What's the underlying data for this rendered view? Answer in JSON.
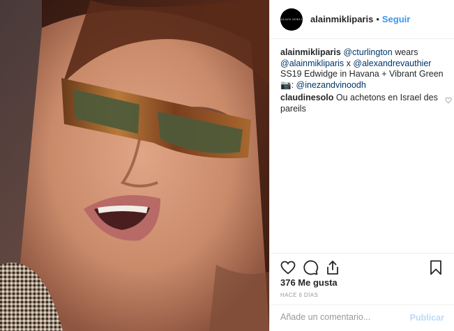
{
  "photo": {
    "alt": "",
    "colors": {
      "hair": "#4a2418",
      "skin": "#c98a6a",
      "lens": "#4d5a3a",
      "frame": "#9a5a2a",
      "lips": "#b86a66",
      "jacket": "#8a7a6a"
    }
  },
  "header": {
    "username": "alainmikliparis",
    "separator": "•",
    "follow_label": "Seguir",
    "avatar_text": "ALAIN MIKLI"
  },
  "caption": {
    "username": "alainmikliparis",
    "parts": [
      "@cturlington",
      " wears ",
      "@alainmikliparis",
      " x ",
      "@alexandrevauthier",
      " SS19 Edwidge in Havana + Vibrant Green ",
      "📷",
      ": ",
      "@inezandvinoodh"
    ]
  },
  "comment": {
    "username": "claudinesolo",
    "text": "Ou achetons en Israel des pareils"
  },
  "actions": {
    "icons": [
      "heart-icon",
      "comment-icon",
      "share-icon",
      "bookmark-icon"
    ]
  },
  "likes": "376 Me gusta",
  "time": "HACE 6 DÍAS",
  "add_comment": {
    "placeholder": "Añade un comentario...",
    "post_label": "Publicar"
  },
  "colors": {
    "accent": "#3897f0",
    "mention": "#003569",
    "text": "#262626",
    "muted": "#999999",
    "border": "#efefef"
  }
}
